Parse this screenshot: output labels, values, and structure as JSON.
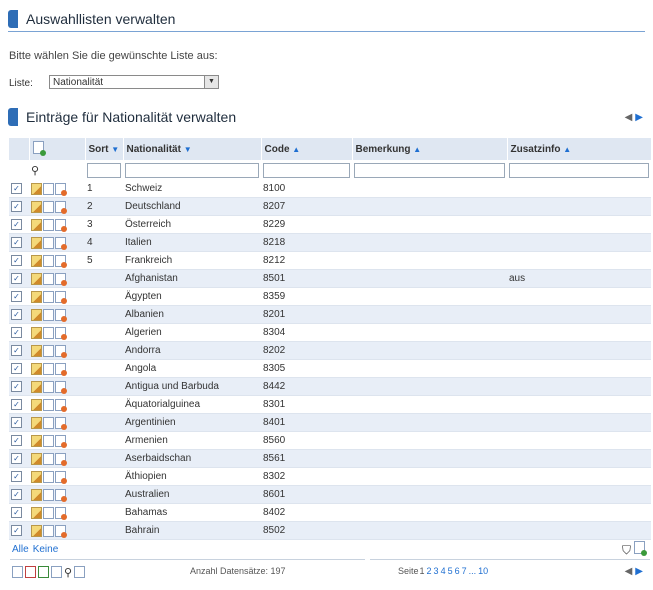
{
  "header1": {
    "title": "Auswahllisten verwalten"
  },
  "prompt": "Bitte wählen Sie die gewünschte Liste aus:",
  "list": {
    "label": "Liste:",
    "selected": "Nationalität"
  },
  "header2": {
    "title": "Einträge für Nationalität verwalten"
  },
  "columns": {
    "sort": "Sort",
    "nationalitaet": "Nationalität",
    "code": "Code",
    "bemerkung": "Bemerkung",
    "zusatzinfo": "Zusatzinfo"
  },
  "rows": [
    {
      "sort": "1",
      "name": "Schweiz",
      "code": "8100",
      "zusatz": ""
    },
    {
      "sort": "2",
      "name": "Deutschland",
      "code": "8207",
      "zusatz": ""
    },
    {
      "sort": "3",
      "name": "Österreich",
      "code": "8229",
      "zusatz": ""
    },
    {
      "sort": "4",
      "name": "Italien",
      "code": "8218",
      "zusatz": ""
    },
    {
      "sort": "5",
      "name": "Frankreich",
      "code": "8212",
      "zusatz": ""
    },
    {
      "sort": "",
      "name": "Afghanistan",
      "code": "8501",
      "zusatz": "aus"
    },
    {
      "sort": "",
      "name": "Ägypten",
      "code": "8359",
      "zusatz": ""
    },
    {
      "sort": "",
      "name": "Albanien",
      "code": "8201",
      "zusatz": ""
    },
    {
      "sort": "",
      "name": "Algerien",
      "code": "8304",
      "zusatz": ""
    },
    {
      "sort": "",
      "name": "Andorra",
      "code": "8202",
      "zusatz": ""
    },
    {
      "sort": "",
      "name": "Angola",
      "code": "8305",
      "zusatz": ""
    },
    {
      "sort": "",
      "name": "Antigua und Barbuda",
      "code": "8442",
      "zusatz": ""
    },
    {
      "sort": "",
      "name": "Äquatorialguinea",
      "code": "8301",
      "zusatz": ""
    },
    {
      "sort": "",
      "name": "Argentinien",
      "code": "8401",
      "zusatz": ""
    },
    {
      "sort": "",
      "name": "Armenien",
      "code": "8560",
      "zusatz": ""
    },
    {
      "sort": "",
      "name": "Aserbaidschan",
      "code": "8561",
      "zusatz": ""
    },
    {
      "sort": "",
      "name": "Äthiopien",
      "code": "8302",
      "zusatz": ""
    },
    {
      "sort": "",
      "name": "Australien",
      "code": "8601",
      "zusatz": ""
    },
    {
      "sort": "",
      "name": "Bahamas",
      "code": "8402",
      "zusatz": ""
    },
    {
      "sort": "",
      "name": "Bahrain",
      "code": "8502",
      "zusatz": ""
    }
  ],
  "footer": {
    "select_all": "Alle",
    "select_none": "Keine",
    "count_label": "Anzahl Datensätze: 197",
    "page_label": "Seite",
    "pages": [
      "1",
      "2",
      "3",
      "4",
      "5",
      "6",
      "7",
      "...",
      "10"
    ]
  },
  "colors": {
    "accent": "#2e6db6",
    "link": "#1f6fd1",
    "row_alt": "#e8eef7",
    "header_bg": "#dfe7f2"
  }
}
